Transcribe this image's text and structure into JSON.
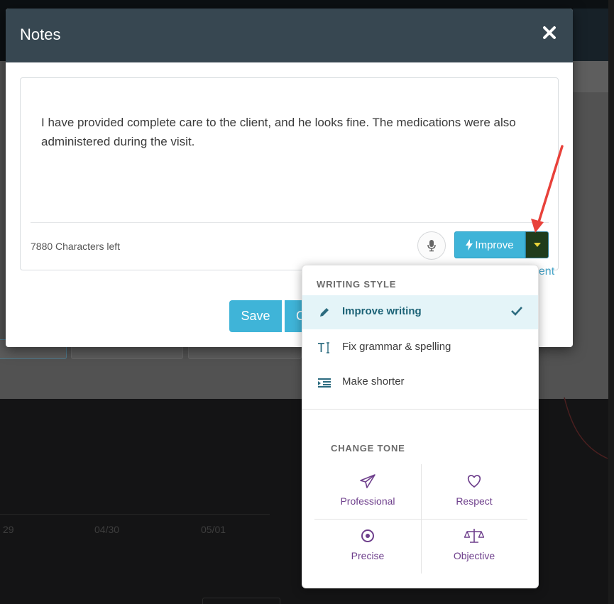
{
  "modal": {
    "title": "Notes",
    "note_text": "I have provided complete care to the client, and he looks fine. The medications were also administered during the visit.",
    "characters_left": "7880 Characters left",
    "improve_label": "Improve",
    "save_label": "Save",
    "second_button_label": "C",
    "link_suffix": "nent"
  },
  "background": {
    "dates": [
      "29",
      "04/30",
      "05/01"
    ]
  },
  "dropdown": {
    "writing_style_title": "WRITING STYLE",
    "items": [
      {
        "label": "Improve writing",
        "icon": "pencil-icon",
        "active": true
      },
      {
        "label": "Fix grammar & spelling",
        "icon": "text-cursor-icon",
        "active": false
      },
      {
        "label": "Make shorter",
        "icon": "indent-icon",
        "active": false
      }
    ],
    "change_tone_title": "CHANGE TONE",
    "tones": [
      {
        "label": "Professional",
        "icon": "paper-plane-icon"
      },
      {
        "label": "Respect",
        "icon": "heart-icon"
      },
      {
        "label": "Precise",
        "icon": "target-icon"
      },
      {
        "label": "Objective",
        "icon": "scale-icon"
      }
    ]
  },
  "colors": {
    "header_bg": "#374751",
    "accent": "#3fb4d8",
    "active_item_bg": "#e4f4f8",
    "tone_text": "#6e3f8c",
    "annotation_arrow": "#e8413a"
  }
}
